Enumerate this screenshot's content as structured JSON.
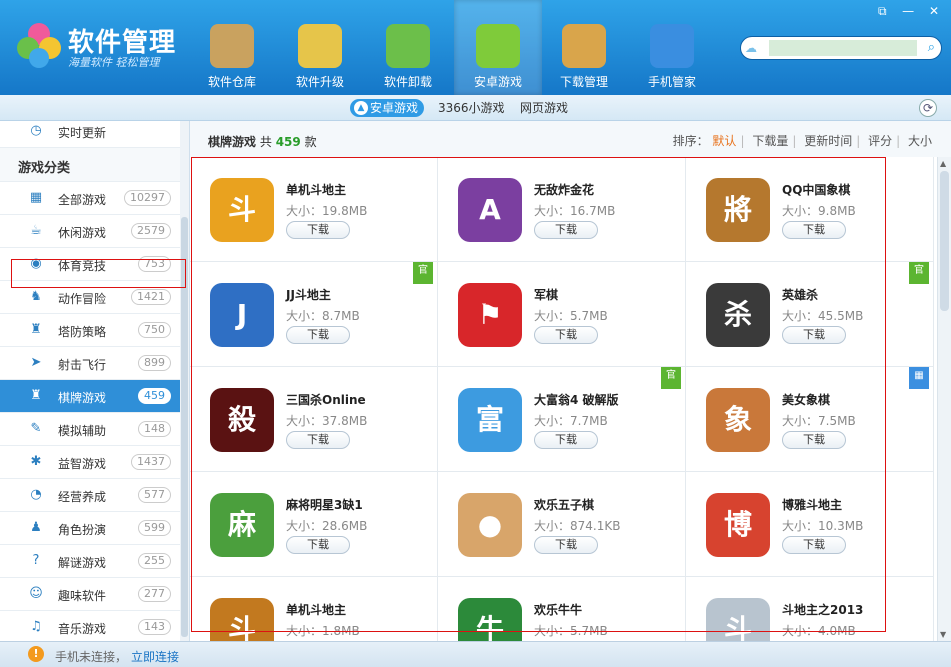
{
  "app": {
    "title": "软件管理",
    "slogan": "海量软件 轻松管理"
  },
  "nav": [
    {
      "label": "软件仓库",
      "icon": "disc-icon",
      "color": "#c9a25f"
    },
    {
      "label": "软件升级",
      "icon": "upgrade-disc-icon",
      "color": "#e6c54a"
    },
    {
      "label": "软件卸载",
      "icon": "recycle-bin-icon",
      "color": "#6cbf4a"
    },
    {
      "label": "安卓游戏",
      "icon": "android-game-icon",
      "color": "#7fcb3a"
    },
    {
      "label": "下载管理",
      "icon": "download-box-icon",
      "color": "#d9a54b"
    },
    {
      "label": "手机管家",
      "icon": "shield-icon",
      "color": "#3a8ee0"
    }
  ],
  "window": {
    "restore": "⧉",
    "minimize": "—",
    "close": "✕"
  },
  "search": {
    "placeholder": ""
  },
  "subnav": {
    "android": "安卓游戏",
    "mini": "3366小游戏",
    "web": "网页游戏",
    "android_icon": "▲"
  },
  "sidebar": {
    "top_item": "实时更新",
    "category_header": "游戏分类",
    "items": [
      {
        "label": "全部游戏",
        "count": "10297",
        "icon": "▦"
      },
      {
        "label": "休闲游戏",
        "count": "2579",
        "icon": "☕"
      },
      {
        "label": "体育竞技",
        "count": "753",
        "icon": "◉"
      },
      {
        "label": "动作冒险",
        "count": "1421",
        "icon": "♞"
      },
      {
        "label": "塔防策略",
        "count": "750",
        "icon": "♜"
      },
      {
        "label": "射击飞行",
        "count": "899",
        "icon": "➤"
      },
      {
        "label": "棋牌游戏",
        "count": "459",
        "icon": "♜"
      },
      {
        "label": "模拟辅助",
        "count": "148",
        "icon": "✎"
      },
      {
        "label": "益智游戏",
        "count": "1437",
        "icon": "✱"
      },
      {
        "label": "经营养成",
        "count": "577",
        "icon": "◔"
      },
      {
        "label": "角色扮演",
        "count": "599",
        "icon": "♟"
      },
      {
        "label": "解谜游戏",
        "count": "255",
        "icon": "?"
      },
      {
        "label": "趣味软件",
        "count": "277",
        "icon": "☺"
      },
      {
        "label": "音乐游戏",
        "count": "143",
        "icon": "♫"
      }
    ]
  },
  "main": {
    "category": "棋牌游戏",
    "total_prefix": "共",
    "total": "459",
    "total_suffix": "款",
    "sort_label": "排序：",
    "sort": [
      "默认",
      "下载量",
      "更新时间",
      "评分",
      "大小"
    ]
  },
  "apps": [
    {
      "name": "单机斗地主",
      "size": "大小：19.8MB",
      "color": "#e9a21f",
      "glyph": "斗",
      "badge": ""
    },
    {
      "name": "无敌炸金花",
      "size": "大小：16.7MB",
      "color": "#7b3fa0",
      "glyph": "A",
      "badge": ""
    },
    {
      "name": "QQ中国象棋",
      "size": "大小：9.8MB",
      "color": "#b5782e",
      "glyph": "將",
      "badge": ""
    },
    {
      "name": "JJ斗地主",
      "size": "大小：8.7MB",
      "color": "#2f6fc4",
      "glyph": "J",
      "badge": "官"
    },
    {
      "name": "军棋",
      "size": "大小：5.7MB",
      "color": "#d8262a",
      "glyph": "⚑",
      "badge": ""
    },
    {
      "name": "英雄杀",
      "size": "大小：45.5MB",
      "color": "#3a3a3a",
      "glyph": "杀",
      "badge": "官"
    },
    {
      "name": "三国杀Online",
      "size": "大小：37.8MB",
      "color": "#5a1212",
      "glyph": "殺",
      "badge": ""
    },
    {
      "name": "大富翁4 破解版",
      "size": "大小：7.7MB",
      "color": "#3d9be0",
      "glyph": "富",
      "badge": "官"
    },
    {
      "name": "美女象棋",
      "size": "大小：7.5MB",
      "color": "#c9783a",
      "glyph": "象",
      "badge": "▦"
    },
    {
      "name": "麻将明星3缺1",
      "size": "大小：28.6MB",
      "color": "#4b9f3d",
      "glyph": "麻",
      "badge": ""
    },
    {
      "name": "欢乐五子棋",
      "size": "大小：874.1KB",
      "color": "#d8a56a",
      "glyph": "●",
      "badge": ""
    },
    {
      "name": "博雅斗地主",
      "size": "大小：10.3MB",
      "color": "#d7432f",
      "glyph": "博",
      "badge": ""
    },
    {
      "name": "单机斗地主",
      "size": "大小：1.8MB",
      "color": "#c2791f",
      "glyph": "斗",
      "badge": ""
    },
    {
      "name": "欢乐牛牛",
      "size": "大小：5.7MB",
      "color": "#2c8a3a",
      "glyph": "牛",
      "badge": ""
    },
    {
      "name": "斗地主之2013",
      "size": "大小：4.0MB",
      "color": "#b8c4cf",
      "glyph": "斗",
      "badge": ""
    }
  ],
  "download_label": "下载",
  "status": {
    "text": "手机未连接，",
    "link": "立即连接",
    "icon": "!"
  }
}
